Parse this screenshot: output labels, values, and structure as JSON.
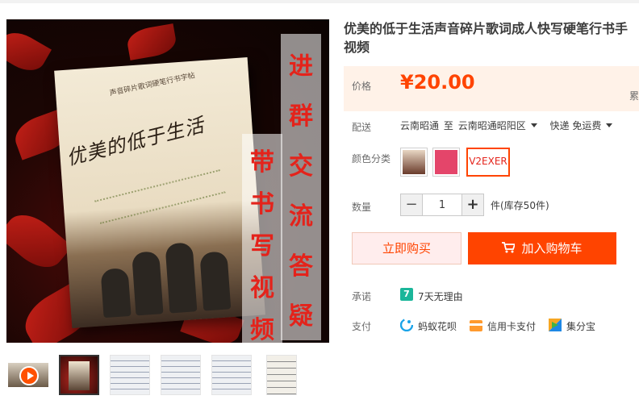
{
  "gallery": {
    "overlay_text_right": "进群交流答疑",
    "overlay_text_left": "带书写视频",
    "book_cover_small_text": "声音碎片歌词硬笔行书字帖",
    "book_cover_script": "优美的低于生活"
  },
  "product": {
    "title": "优美的低于生活声音碎片歌词成人快写硬笔行书手视频"
  },
  "price": {
    "label": "价格",
    "value": "¥20.00",
    "cutoff": "累"
  },
  "delivery": {
    "label": "配送",
    "from": "云南昭通",
    "to_word": "至",
    "to": "云南昭通昭阳区",
    "shipping": "快递 免运费"
  },
  "sku": {
    "label": "颜色分类",
    "options": [
      "",
      "",
      "V2EXER"
    ],
    "selected_index": 2
  },
  "quantity": {
    "label": "数量",
    "value": "1",
    "minus": "−",
    "plus": "+",
    "stock": "件(库存50件)"
  },
  "actions": {
    "buy_now": "立即购买",
    "add_to_cart": "加入购物车"
  },
  "promise": {
    "label": "承诺",
    "badge": "7",
    "text": "7天无理由"
  },
  "payment": {
    "label": "支付",
    "methods": [
      "蚂蚁花呗",
      "信用卡支付",
      "集分宝"
    ]
  },
  "colors": {
    "accent": "#ff4400",
    "price_bg": "#fff2e8",
    "promise_green": "#1bb69a"
  }
}
